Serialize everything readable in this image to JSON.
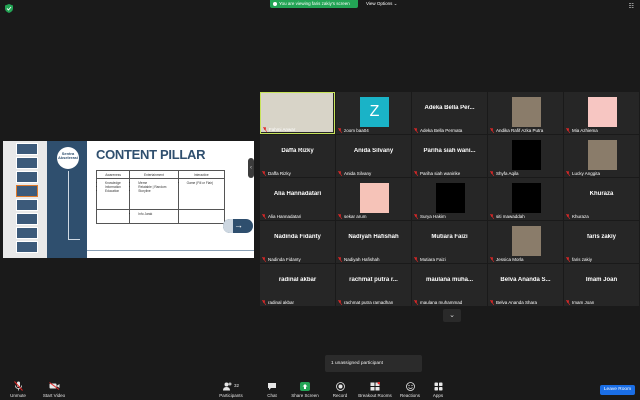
{
  "topbar": {
    "share_notice": "You are viewing faris zakiy's screen",
    "view_options": "View Options ⌄"
  },
  "shared_screen": {
    "slide_title": "CONTENT PILLAR",
    "logo_text": "Sentra Akselerasi",
    "table_headers": [
      "Awareness",
      "Entertainment",
      "Interactive"
    ],
    "table_cells": [
      [
        "Knowledge",
        "Information",
        "Education"
      ],
      [
        "Meme",
        "Relatable | Random",
        "Storyline"
      ],
      [
        "Game (Fill or Flair)"
      ]
    ],
    "table_row2": [
      "",
      "Info Jarak",
      ""
    ]
  },
  "participants": [
    {
      "label": "Fahmi Anwar",
      "display": "",
      "pic": "fahmi"
    },
    {
      "label": "zoom baa04",
      "display": "",
      "pic": "teal",
      "letter": "Z"
    },
    {
      "label": "Adeka Bella Permata",
      "display": "Adeka Bella Per...",
      "pic": ""
    },
    {
      "label": "Andika Rafif Azka Putra",
      "display": "",
      "pic": "face"
    },
    {
      "label": "Mia Azhiema",
      "display": "",
      "pic": "pink"
    },
    {
      "label": "Daffa Rizky",
      "display": "Daffa Rizky",
      "pic": ""
    },
    {
      "label": "Anida Silvany",
      "display": "Anida Silvany",
      "pic": ""
    },
    {
      "label": "Pariha siah wanirike",
      "display": "Pariha siah wani...",
      "pic": ""
    },
    {
      "label": "Shyfa Aqila",
      "display": "",
      "pic": "black"
    },
    {
      "label": "Lucky Anggita",
      "display": "",
      "pic": "face"
    },
    {
      "label": "Alia Hannadatari",
      "display": "Alia Hannadatari",
      "pic": ""
    },
    {
      "label": "sekar arum",
      "display": "",
      "pic": "peach"
    },
    {
      "label": "Surya Hakim",
      "display": "",
      "pic": "black"
    },
    {
      "label": "siti mawaddah",
      "display": "",
      "pic": "black"
    },
    {
      "label": "Khuraza",
      "display": "Khuraza",
      "pic": ""
    },
    {
      "label": "Nadinda Fidanty",
      "display": "Nadinda Fidanty",
      "pic": ""
    },
    {
      "label": "Nadiyah Hafishah",
      "display": "Nadiyah Hafishah",
      "pic": ""
    },
    {
      "label": "Mutiara Faizi",
      "display": "Mutiara Faizi",
      "pic": ""
    },
    {
      "label": "Jessica Morla",
      "display": "",
      "pic": "face"
    },
    {
      "label": "faris zakiy",
      "display": "faris zakiy",
      "pic": ""
    },
    {
      "label": "radinal akbar",
      "display": "radinal akbar",
      "pic": ""
    },
    {
      "label": "rachmat putra ramadhan",
      "display": "rachmat putra r...",
      "pic": ""
    },
    {
      "label": "maulana muhammad",
      "display": "maulana muha...",
      "pic": ""
    },
    {
      "label": "Belva Ananda Shara",
      "display": "Belva Ananda S...",
      "pic": ""
    },
    {
      "label": "Imam Joan",
      "display": "Imam Joan",
      "pic": ""
    }
  ],
  "unassigned": "1 unassigned participant",
  "toolbar": {
    "unmute": "Unmute",
    "start_video": "Start Video",
    "participants": "Participants",
    "participants_count": "32",
    "chat": "Chat",
    "share_screen": "Share Screen",
    "record": "Record",
    "breakout_rooms": "Breakout Rooms",
    "reactions": "Reactions",
    "apps": "Apps",
    "leave_room": "Leave Room"
  },
  "colors": {
    "share_green": "#23a455",
    "active_speaker": "#c7e35a",
    "leave_blue": "#1a6ee6",
    "muted_red": "#e02828"
  },
  "icons": [
    "shield-icon",
    "grid-view-icon",
    "mic-muted-icon",
    "video-off-icon",
    "participants-icon",
    "chat-icon",
    "share-screen-icon",
    "record-icon",
    "breakout-rooms-icon",
    "reactions-icon",
    "apps-icon",
    "chevron-down-icon"
  ]
}
